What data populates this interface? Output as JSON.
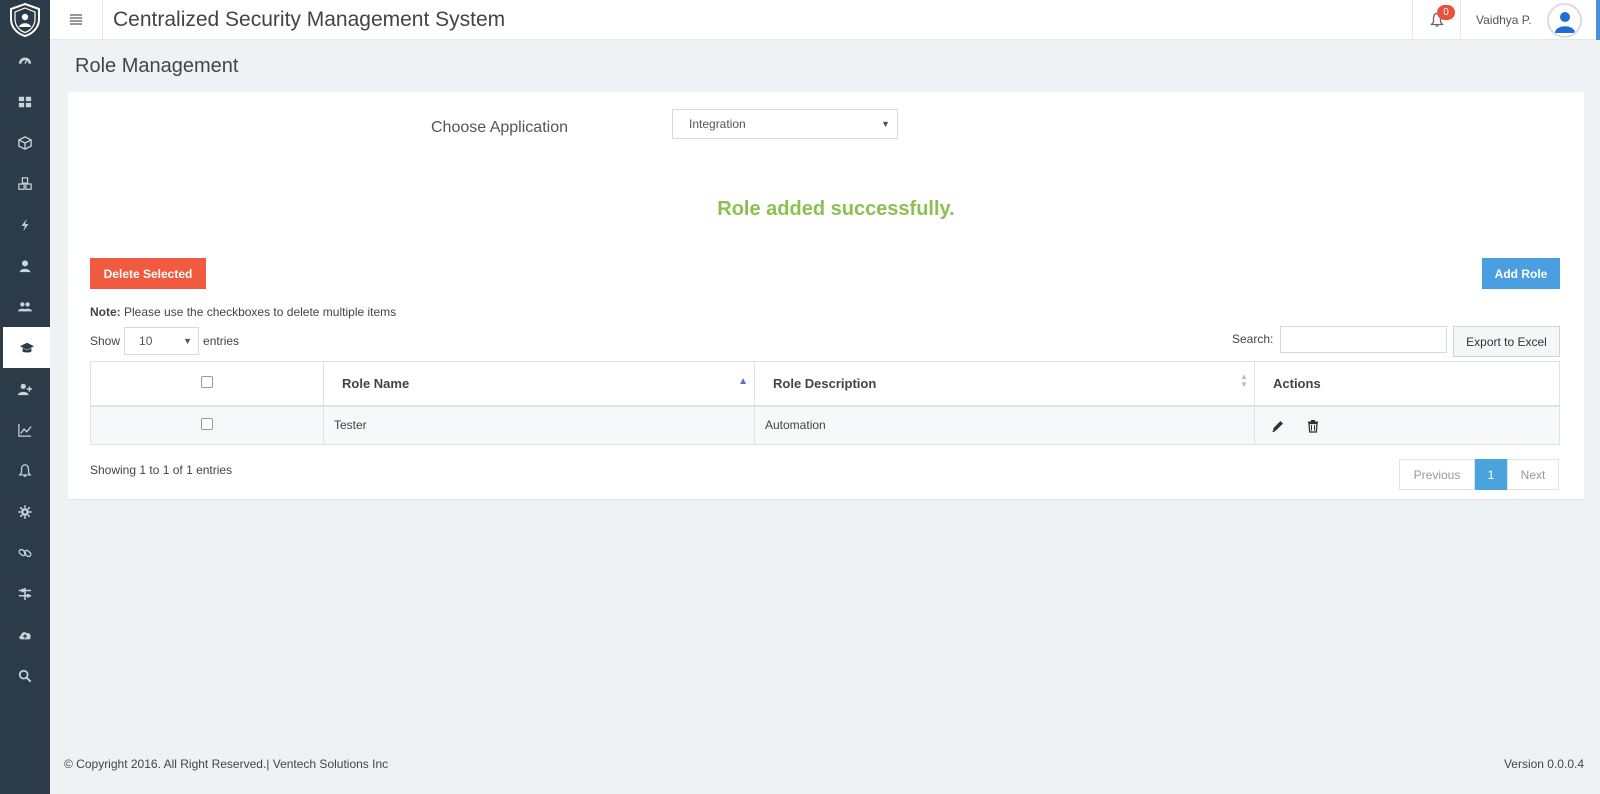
{
  "header": {
    "title": "Centralized Security Management System",
    "notification_count": "0",
    "user_name": "Vaidhya P."
  },
  "sidebar": {
    "items": [
      {
        "icon": "dashboard-icon"
      },
      {
        "icon": "grid-icon"
      },
      {
        "icon": "cube-icon"
      },
      {
        "icon": "cubes-icon"
      },
      {
        "icon": "bolt-icon"
      },
      {
        "icon": "user-icon"
      },
      {
        "icon": "users-icon"
      },
      {
        "icon": "graduation-cap-icon",
        "active": true
      },
      {
        "icon": "user-plus-icon"
      },
      {
        "icon": "line-chart-icon"
      },
      {
        "icon": "bell-icon"
      },
      {
        "icon": "gear-icon"
      },
      {
        "icon": "link-icon"
      },
      {
        "icon": "sliders-icon"
      },
      {
        "icon": "cloud-upload-icon"
      },
      {
        "icon": "search-icon"
      }
    ]
  },
  "page": {
    "title": "Role Management",
    "choose_label": "Choose Application",
    "application_selected": "Integration",
    "success_message": "Role added successfully.",
    "delete_label": "Delete Selected",
    "add_label": "Add Role",
    "note_bold": "Note:",
    "note_text": " Please use the checkboxes to delete multiple items",
    "show_label": "Show",
    "entries_value": "10",
    "entries_label": "entries",
    "search_label": "Search:",
    "search_value": "",
    "export_label": "Export to Excel"
  },
  "table": {
    "columns": [
      "Role Name",
      "Role Description",
      "Actions"
    ],
    "rows": [
      {
        "role_name": "Tester",
        "role_description": "Automation"
      }
    ]
  },
  "pagination": {
    "info": "Showing 1 to 1 of 1 entries",
    "previous": "Previous",
    "current": "1",
    "next": "Next"
  },
  "footer": {
    "copyright": "© Copyright 2016. All Right Reserved.| Ventech Solutions Inc",
    "version": "Version 0.0.0.4"
  },
  "colors": {
    "sidebar": "#2c3b48",
    "success": "#8cc152",
    "danger": "#f05a3e",
    "primary": "#4a9fe0"
  }
}
